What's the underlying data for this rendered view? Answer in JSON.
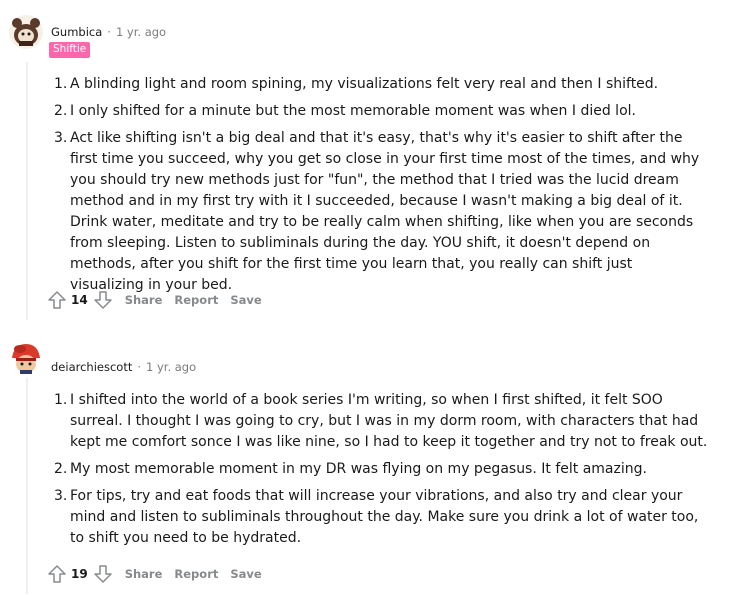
{
  "comments": [
    {
      "author": "Gumbica",
      "age": "1 yr. ago",
      "flair": "Shiftie",
      "items": [
        "A blinding light and room spining, my visualizations felt very real and then I shifted.",
        "I only shifted for a minute but the most memorable moment was when I died lol.",
        "Act like shifting isn't a big deal and that it's easy, that's why it's easier to shift after the first time you succeed, why you get so close in your first time most of the times, and why you should try new methods just for \"fun\", the method that I tried was the lucid dream method and in my first try with it I succeeded, because I wasn't making a big deal of it. Drink water, meditate and try to be really calm when shifting, like when you are seconds from sleeping. Listen to subliminals during the day. YOU shift, it doesn't depend on methods, after you shift for the first time you learn that, you really can shift just visualizing in your bed."
      ],
      "score": "14",
      "share": "Share",
      "report": "Report",
      "save": "Save"
    },
    {
      "author": "deiarchiescott",
      "age": "1 yr. ago",
      "items": [
        "I shifted into the world of a book series I'm writing, so when I first shifted, it felt SOO surreal. I thought I was going to cry, but I was in my dorm room, with characters that had kept me comfort sonce I was like nine, so I had to keep it together and try not to freak out.",
        "My most memorable moment in my DR was flying on my pegasus. It felt amazing.",
        "For tips, try and eat foods that will increase your vibrations, and also try and clear your mind and listen to subliminals throughout the day. Make sure you drink a lot of water too, to shift you need to be hydrated."
      ],
      "score": "19",
      "share": "Share",
      "report": "Report",
      "save": "Save"
    }
  ],
  "numbers": [
    "1.",
    "2.",
    "3."
  ],
  "separator": "·"
}
